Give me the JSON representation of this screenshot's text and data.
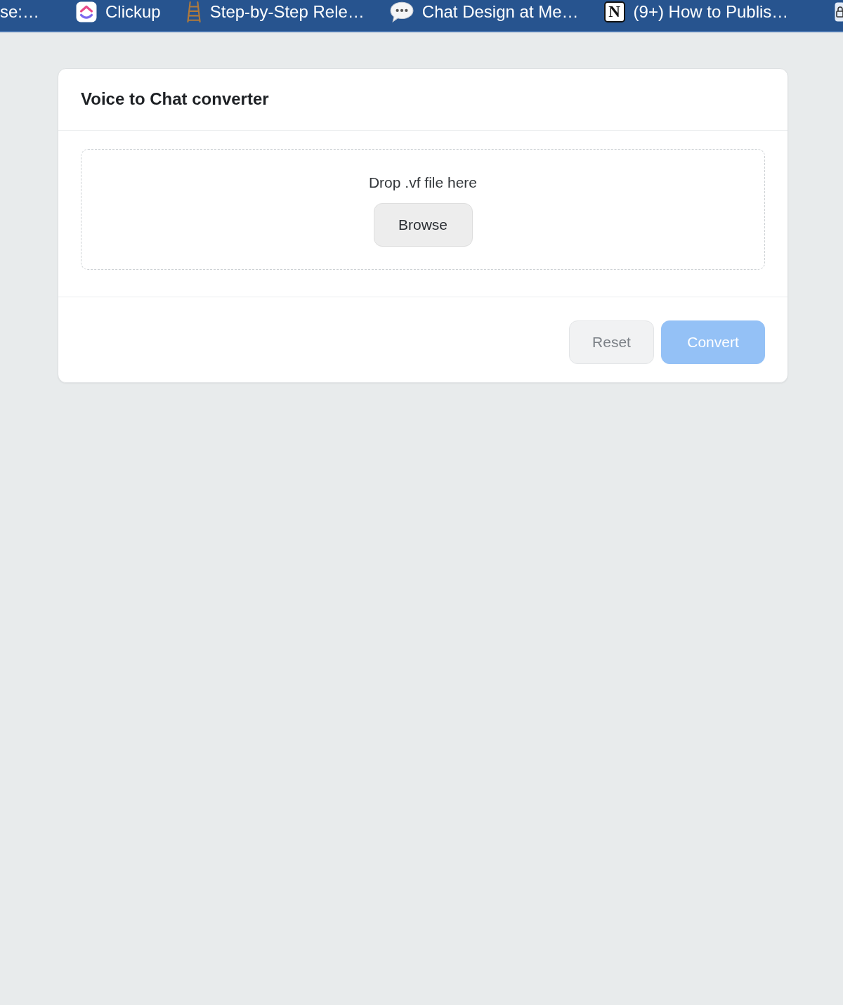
{
  "bookmarks": [
    {
      "kind": "plain",
      "label": "se:…"
    },
    {
      "kind": "tile",
      "label": "Clickup"
    },
    {
      "kind": "ladder",
      "label": "Step-by-Step Rele…"
    },
    {
      "kind": "bubble",
      "label": "Chat Design at Me…"
    },
    {
      "kind": "letter",
      "glyph": "N",
      "label": "(9+) How to Publis…"
    },
    {
      "kind": "lock"
    }
  ],
  "card": {
    "title": "Voice to Chat converter",
    "dropzone": {
      "prompt": "Drop .vf file here",
      "button": {
        "label": "Browse",
        "disabled": false
      }
    },
    "actions": [
      {
        "kind": "secondary",
        "label": "Reset",
        "disabled": true
      },
      {
        "kind": "primary",
        "label": "Convert",
        "disabled": true
      }
    ]
  }
}
